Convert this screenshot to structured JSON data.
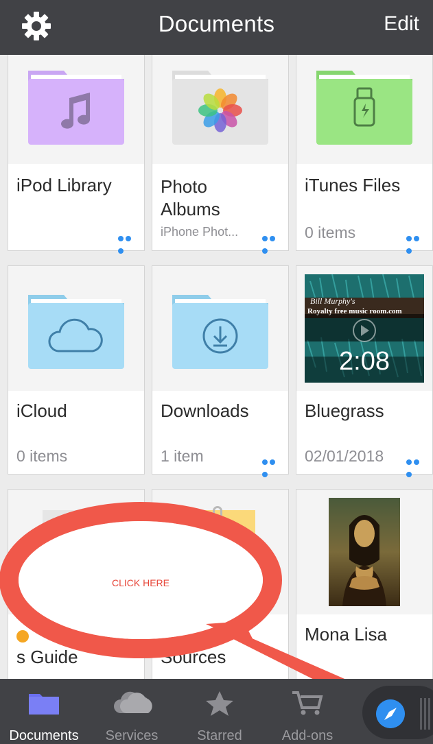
{
  "header": {
    "title": "Documents",
    "edit_label": "Edit",
    "bg_color": "#414246"
  },
  "items": [
    {
      "name": "iPod Library",
      "meta": "",
      "icon": "music-note-icon"
    },
    {
      "name": "Photo Albums",
      "meta": "iPhone Phot...",
      "icon": "photos-flower-icon"
    },
    {
      "name": "iTunes Files",
      "meta": "0 items",
      "icon": "usb-connector-icon"
    },
    {
      "name": "iCloud",
      "meta": "0 items",
      "icon": "cloud-icon"
    },
    {
      "name": "Downloads",
      "meta": "1 item",
      "icon": "download-icon"
    },
    {
      "name": "Bluegrass",
      "meta": "02/01/2018",
      "icon": "video-thumbnail",
      "video_title": "Bill Murphy's",
      "video_subtitle": "Royalty free music room.com",
      "video_duration": "2:08"
    },
    {
      "name": "s Guide",
      "meta": "",
      "icon": "document-thumbnail"
    },
    {
      "name": "Sources",
      "meta": "",
      "icon": "document-thumbnail"
    },
    {
      "name": "Mona Lisa",
      "meta": "",
      "icon": "image-thumbnail"
    }
  ],
  "overlay": {
    "text": "CLICK HERE",
    "color": "#f0584a"
  },
  "tabbar": {
    "tabs": [
      {
        "label": "Documents",
        "active": true
      },
      {
        "label": "Services",
        "active": false
      },
      {
        "label": "Starred",
        "active": false
      },
      {
        "label": "Add-ons",
        "active": false
      }
    ],
    "accent": "#2f8ff0"
  }
}
